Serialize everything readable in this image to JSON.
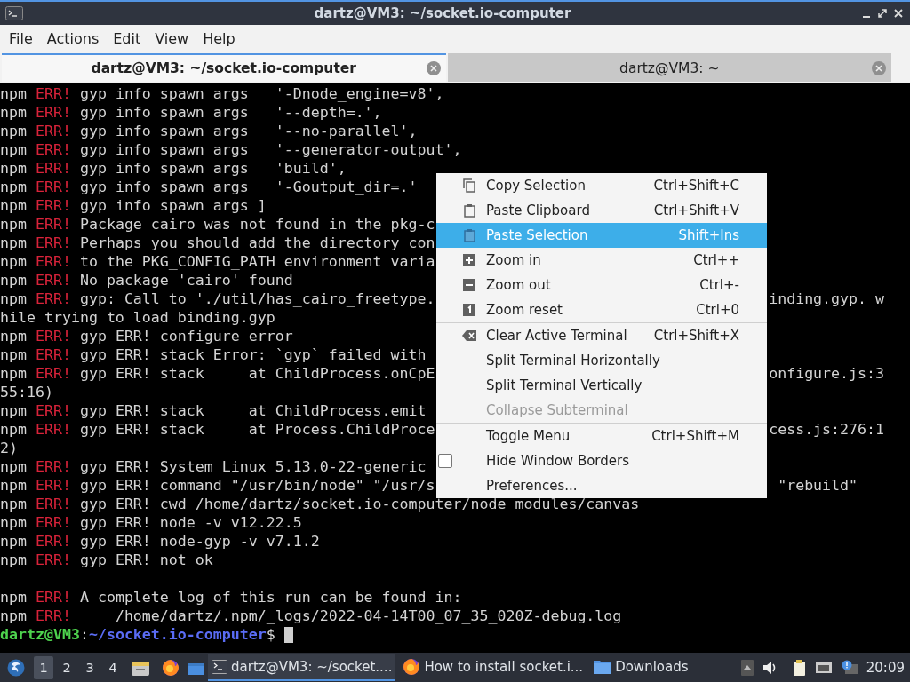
{
  "window": {
    "title": "dartz@VM3: ~/socket.io-computer"
  },
  "menubar": [
    "File",
    "Actions",
    "Edit",
    "View",
    "Help"
  ],
  "tabs": [
    {
      "label": "dartz@VM3: ~/socket.io-computer",
      "selected": true
    },
    {
      "label": "dartz@VM3: ~",
      "selected": false
    }
  ],
  "terminal": {
    "lines": [
      {
        "kind": "log",
        "prefix": "npm",
        "tag": "ERR!",
        "text": "gyp info spawn args   '-Dnode_engine=v8',"
      },
      {
        "kind": "log",
        "prefix": "npm",
        "tag": "ERR!",
        "text": "gyp info spawn args   '--depth=.',"
      },
      {
        "kind": "log",
        "prefix": "npm",
        "tag": "ERR!",
        "text": "gyp info spawn args   '--no-parallel',"
      },
      {
        "kind": "log",
        "prefix": "npm",
        "tag": "ERR!",
        "text": "gyp info spawn args   '--generator-output',"
      },
      {
        "kind": "log",
        "prefix": "npm",
        "tag": "ERR!",
        "text": "gyp info spawn args   'build',"
      },
      {
        "kind": "log",
        "prefix": "npm",
        "tag": "ERR!",
        "text": "gyp info spawn args   '-Goutput_dir=.'"
      },
      {
        "kind": "log",
        "prefix": "npm",
        "tag": "ERR!",
        "text": "gyp info spawn args ]"
      },
      {
        "kind": "log",
        "prefix": "npm",
        "tag": "ERR!",
        "text": "Package cairo was not found in the pkg-c"
      },
      {
        "kind": "log",
        "prefix": "npm",
        "tag": "ERR!",
        "text": "Perhaps you should add the directory con"
      },
      {
        "kind": "log",
        "prefix": "npm",
        "tag": "ERR!",
        "text": "to the PKG_CONFIG_PATH environment varia"
      },
      {
        "kind": "log",
        "prefix": "npm",
        "tag": "ERR!",
        "text": "No package 'cairo' found"
      },
      {
        "kind": "log",
        "prefix": "npm",
        "tag": "ERR!",
        "text": "gyp: Call to './util/has_cairo_freetype.",
        "right_text": "inding.gyp. w"
      },
      {
        "kind": "wrap",
        "text": "hile trying to load binding.gyp"
      },
      {
        "kind": "log",
        "prefix": "npm",
        "tag": "ERR!",
        "text": "gyp ERR! configure error"
      },
      {
        "kind": "log",
        "prefix": "npm",
        "tag": "ERR!",
        "text": "gyp ERR! stack Error: `gyp` failed with"
      },
      {
        "kind": "log",
        "prefix": "npm",
        "tag": "ERR!",
        "text": "gyp ERR! stack     at ChildProcess.onCpE",
        "right_text": "onfigure.js:3"
      },
      {
        "kind": "wrap",
        "text": "55:16)"
      },
      {
        "kind": "log",
        "prefix": "npm",
        "tag": "ERR!",
        "text": "gyp ERR! stack     at ChildProcess.emit"
      },
      {
        "kind": "log",
        "prefix": "npm",
        "tag": "ERR!",
        "text": "gyp ERR! stack     at Process.ChildProce",
        "right_text": "cess.js:276:1"
      },
      {
        "kind": "wrap",
        "text": "2)"
      },
      {
        "kind": "log",
        "prefix": "npm",
        "tag": "ERR!",
        "text": "gyp ERR! System Linux 5.13.0-22-generic"
      },
      {
        "kind": "log",
        "prefix": "npm",
        "tag": "ERR!",
        "text": "gyp ERR! command \"/usr/bin/node\" \"/usr/s",
        "right_text": " \"rebuild\""
      },
      {
        "kind": "log",
        "prefix": "npm",
        "tag": "ERR!",
        "text": "gyp ERR! cwd /home/dartz/socket.io-computer/node_modules/canvas"
      },
      {
        "kind": "log",
        "prefix": "npm",
        "tag": "ERR!",
        "text": "gyp ERR! node -v v12.22.5"
      },
      {
        "kind": "log",
        "prefix": "npm",
        "tag": "ERR!",
        "text": "gyp ERR! node-gyp -v v7.1.2"
      },
      {
        "kind": "log",
        "prefix": "npm",
        "tag": "ERR!",
        "text": "gyp ERR! not ok"
      },
      {
        "kind": "blank"
      },
      {
        "kind": "log",
        "prefix": "npm",
        "tag": "ERR!",
        "text": "A complete log of this run can be found in:"
      },
      {
        "kind": "log",
        "prefix": "npm",
        "tag": "ERR!",
        "text": "    /home/dartz/.npm/_logs/2022-04-14T00_07_35_020Z-debug.log"
      }
    ],
    "prompt": {
      "user": "dartz@VM3",
      "separator": ":",
      "path": "~/socket.io-computer",
      "symbol": "$"
    }
  },
  "context_menu": {
    "items": [
      {
        "kind": "action",
        "label": "Copy Selection",
        "shortcut": "Ctrl+Shift+C",
        "selected": false,
        "disabled": false
      },
      {
        "kind": "action",
        "label": "Paste Clipboard",
        "shortcut": "Ctrl+Shift+V",
        "selected": false,
        "disabled": false
      },
      {
        "kind": "action",
        "label": "Paste Selection",
        "shortcut": "Shift+Ins",
        "selected": true,
        "disabled": false
      },
      {
        "kind": "action",
        "label": "Zoom in",
        "shortcut": "Ctrl++",
        "selected": false,
        "disabled": false
      },
      {
        "kind": "action",
        "label": "Zoom out",
        "shortcut": "Ctrl+-",
        "selected": false,
        "disabled": false
      },
      {
        "kind": "action",
        "label": "Zoom reset",
        "shortcut": "Ctrl+0",
        "selected": false,
        "disabled": false
      },
      {
        "kind": "separator"
      },
      {
        "kind": "action",
        "label": "Clear Active Terminal",
        "shortcut": "Ctrl+Shift+X",
        "selected": false,
        "disabled": false
      },
      {
        "kind": "action",
        "label": "Split Terminal Horizontally",
        "selected": false,
        "disabled": false
      },
      {
        "kind": "action",
        "label": "Split Terminal Vertically",
        "selected": false,
        "disabled": false
      },
      {
        "kind": "action",
        "label": "Collapse Subterminal",
        "selected": false,
        "disabled": true
      },
      {
        "kind": "separator"
      },
      {
        "kind": "action",
        "label": "Toggle Menu",
        "shortcut": "Ctrl+Shift+M",
        "selected": false,
        "disabled": false
      },
      {
        "kind": "checkbox",
        "label": "Hide Window Borders",
        "checked": false,
        "selected": false,
        "disabled": false
      },
      {
        "kind": "action",
        "label": "Preferences...",
        "selected": false,
        "disabled": false
      }
    ]
  },
  "taskbar": {
    "workspaces": [
      {
        "label": "1",
        "selected": true
      },
      {
        "label": "2",
        "selected": false
      },
      {
        "label": "3",
        "selected": false
      },
      {
        "label": "4",
        "selected": false
      }
    ],
    "tasks": [
      {
        "label": "dartz@VM3: ~/socket....",
        "selected": true
      },
      {
        "label": "How to install socket.i...",
        "selected": false
      },
      {
        "label": "Downloads",
        "selected": false
      }
    ],
    "clock": "20:09"
  }
}
